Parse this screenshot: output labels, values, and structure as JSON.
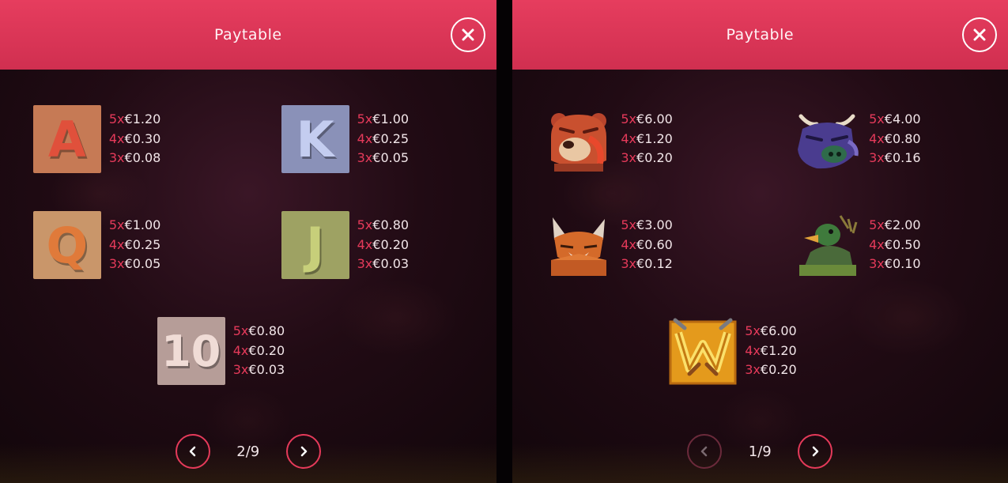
{
  "panels": [
    {
      "header_title": "Paytable",
      "page_indicator": "2/9",
      "prev_disabled": false,
      "symbols": [
        {
          "symbol": "A",
          "pays": [
            [
              "5x",
              "€1.20"
            ],
            [
              "4x",
              "€0.30"
            ],
            [
              "3x",
              "€0.08"
            ]
          ],
          "color": "#e0503b",
          "tile": "#c67a55"
        },
        {
          "symbol": "K",
          "pays": [
            [
              "5x",
              "€1.00"
            ],
            [
              "4x",
              "€0.25"
            ],
            [
              "3x",
              "€0.05"
            ]
          ],
          "color": "#7c89c9",
          "tile": "#8a91b8"
        },
        {
          "symbol": "Q",
          "pays": [
            [
              "5x",
              "€1.00"
            ],
            [
              "4x",
              "€0.25"
            ],
            [
              "3x",
              "€0.05"
            ]
          ],
          "color": "#d4763a",
          "tile": "#c9966a"
        },
        {
          "symbol": "J",
          "pays": [
            [
              "5x",
              "€0.80"
            ],
            [
              "4x",
              "€0.20"
            ],
            [
              "3x",
              "€0.03"
            ]
          ],
          "color": "#a4b057",
          "tile": "#9ea263"
        },
        {
          "symbol": "10",
          "pays": [
            [
              "5x",
              "€0.80"
            ],
            [
              "4x",
              "€0.20"
            ],
            [
              "3x",
              "€0.03"
            ]
          ],
          "color": "#e8c9c3",
          "tile": "#b69d98"
        }
      ]
    },
    {
      "header_title": "Paytable",
      "page_indicator": "1/9",
      "prev_disabled": true,
      "symbols": [
        {
          "symbol": "bear-icon",
          "pays": [
            [
              "5x",
              "€6.00"
            ],
            [
              "4x",
              "€1.20"
            ],
            [
              "3x",
              "€0.20"
            ]
          ]
        },
        {
          "symbol": "bull-icon",
          "pays": [
            [
              "5x",
              "€4.00"
            ],
            [
              "4x",
              "€0.80"
            ],
            [
              "3x",
              "€0.16"
            ]
          ]
        },
        {
          "symbol": "fox-icon",
          "pays": [
            [
              "5x",
              "€3.00"
            ],
            [
              "4x",
              "€0.60"
            ],
            [
              "3x",
              "€0.12"
            ]
          ]
        },
        {
          "symbol": "duck-icon",
          "pays": [
            [
              "5x",
              "€2.00"
            ],
            [
              "4x",
              "€0.50"
            ],
            [
              "3x",
              "€0.10"
            ]
          ]
        },
        {
          "symbol": "wild-icon",
          "pays": [
            [
              "5x",
              "€6.00"
            ],
            [
              "4x",
              "€1.20"
            ],
            [
              "3x",
              "€0.20"
            ]
          ]
        }
      ]
    }
  ],
  "colors": {
    "header": "#d9365a",
    "accent": "#e53a5a",
    "text": "#f2e6e9"
  }
}
